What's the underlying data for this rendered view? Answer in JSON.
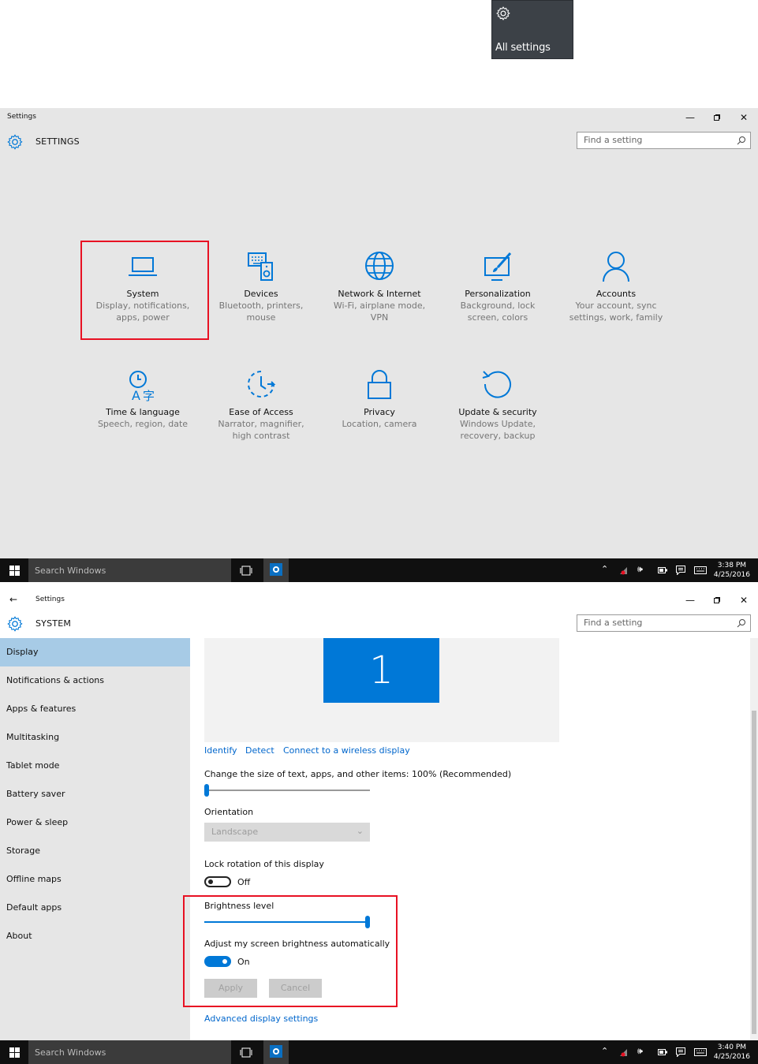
{
  "tile": {
    "label": "All settings",
    "icon": "gear-icon"
  },
  "window1": {
    "title": "Settings",
    "header": "SETTINGS",
    "search_placeholder": "Find a setting",
    "time": "3:38 PM",
    "date": "4/25/2016",
    "categories": [
      {
        "name": "System",
        "desc1": "Display, notifications,",
        "desc2": "apps, power",
        "icon": "laptop-icon"
      },
      {
        "name": "Devices",
        "desc1": "Bluetooth, printers,",
        "desc2": "mouse",
        "icon": "devices-icon"
      },
      {
        "name": "Network & Internet",
        "desc1": "Wi-Fi, airplane mode,",
        "desc2": "VPN",
        "icon": "globe-icon"
      },
      {
        "name": "Personalization",
        "desc1": "Background, lock",
        "desc2": "screen, colors",
        "icon": "paintbrush-icon"
      },
      {
        "name": "Accounts",
        "desc1": "Your account, sync",
        "desc2": "settings, work, family",
        "icon": "person-icon"
      },
      {
        "name": "Time & language",
        "desc1": "Speech, region, date",
        "desc2": "",
        "icon": "time-language-icon"
      },
      {
        "name": "Ease of Access",
        "desc1": "Narrator, magnifier,",
        "desc2": "high contrast",
        "icon": "ease-of-access-icon"
      },
      {
        "name": "Privacy",
        "desc1": "Location, camera",
        "desc2": "",
        "icon": "lock-icon"
      },
      {
        "name": "Update & security",
        "desc1": "Windows Update,",
        "desc2": "recovery, backup",
        "icon": "refresh-icon"
      }
    ]
  },
  "taskbar": {
    "search_placeholder": "Search Windows"
  },
  "window2": {
    "title": "Settings",
    "header": "SYSTEM",
    "search_placeholder": "Find a setting",
    "time": "3:40 PM",
    "date": "4/25/2016",
    "sidebar": [
      "Display",
      "Notifications & actions",
      "Apps & features",
      "Multitasking",
      "Tablet mode",
      "Battery saver",
      "Power & sleep",
      "Storage",
      "Offline maps",
      "Default apps",
      "About"
    ],
    "monitor_number": "1",
    "links": {
      "identify": "Identify",
      "detect": "Detect",
      "connect": "Connect to a wireless display",
      "advanced": "Advanced display settings"
    },
    "scale_label": "Change the size of text, apps, and other items: 100% (Recommended)",
    "scale_level": 0,
    "orientation_label": "Orientation",
    "orientation_value": "Landscape",
    "lock_rotation_label": "Lock rotation of this display",
    "lock_rotation_state": "Off",
    "brightness_label": "Brightness level",
    "brightness_level": 1.0,
    "auto_brightness_label": "Adjust my screen brightness automatically",
    "auto_brightness_state": "On",
    "apply_label": "Apply",
    "cancel_label": "Cancel"
  }
}
